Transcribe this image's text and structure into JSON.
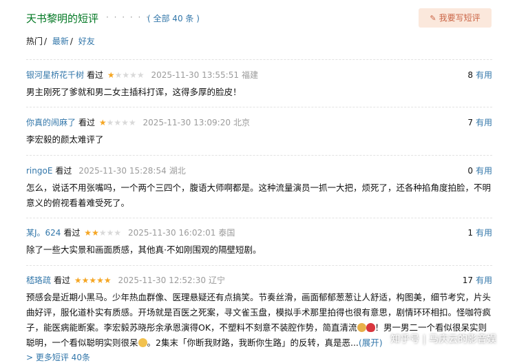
{
  "header": {
    "title": "天书黎明的短评",
    "dots": "· · · · · ·",
    "all_count": "( 全部 40 条 )",
    "write_button": "我要写短评"
  },
  "filters": {
    "active": "热门",
    "sep": "/",
    "latest": "最新",
    "friends": "好友"
  },
  "comments": [
    {
      "user": "银河星桥花千树",
      "seen": "看过",
      "rating": 1,
      "time": "2025-11-30 13:55:51",
      "location": "福建",
      "votes": "8",
      "votes_label": "有用",
      "text": "男主刚死了爹就和男二女主插科打诨，这得多厚的脸皮！"
    },
    {
      "user": "你真的闹麻了",
      "seen": "看过",
      "rating": 1,
      "time": "2025-11-30 13:09:20",
      "location": "北京",
      "votes": "7",
      "votes_label": "有用",
      "text": "李宏毅的颜太难评了"
    },
    {
      "user": "ringoE",
      "seen": "看过",
      "rating": 0,
      "time": "2025-11-30 15:28:54",
      "location": "湖北",
      "votes": "0",
      "votes_label": "有用",
      "text": "怎么，说话不用张嘴吗，一个两个三四个，腹语大师啊都是。这种流量演员一抓一大把，烦死了，还各种掐角度拍脸，不明意义的俯视看着难受死了。"
    },
    {
      "user": "某J。624",
      "seen": "看过",
      "rating": 2,
      "time": "2025-11-30 16:02:01",
      "location": "泰国",
      "votes": "1",
      "votes_label": "有用",
      "text": "除了一些大实景和画面质感，其他真·不如刚围观的隔壁短剧。"
    },
    {
      "user": "嵇珞疏",
      "seen": "看过",
      "rating": 5,
      "time": "2025-11-30 12:52:30",
      "location": "辽宁",
      "votes": "17",
      "votes_label": "有用",
      "text_a": "预感会是近期小黑马。少年热血群像、医理悬疑还有点搞笑。节奏丝滑，画面郁郁葱葱让人舒适，构图美，细节考究，片头曲好评，服化道朴实有质感。开场就是百医之死案，寻文雀玉盘，模拟手术那里拍得也很有意思，剧情环环相扣。怪咖符疯子，能医病能断案。李宏毅苏晓彤余承恩演得OK，不塑料不刻意不装腔作势，简直清流",
      "text_b": "！男一男二一个看似很呆实则聪明，一个看似聪明实则很呆",
      "text_c": "。2集末「你断我财路，我断你生路」的反转，真是恶...",
      "expand": "(展开)"
    }
  ],
  "more": "> 更多短评 40条",
  "watermark": "知乎号 | 马庆云的影音娱",
  "colors": {
    "title_green": "#007722",
    "link_blue": "#3377aa",
    "star": "#f5a623",
    "button_bg": "#fbe8dc",
    "button_text": "#ca6445"
  }
}
